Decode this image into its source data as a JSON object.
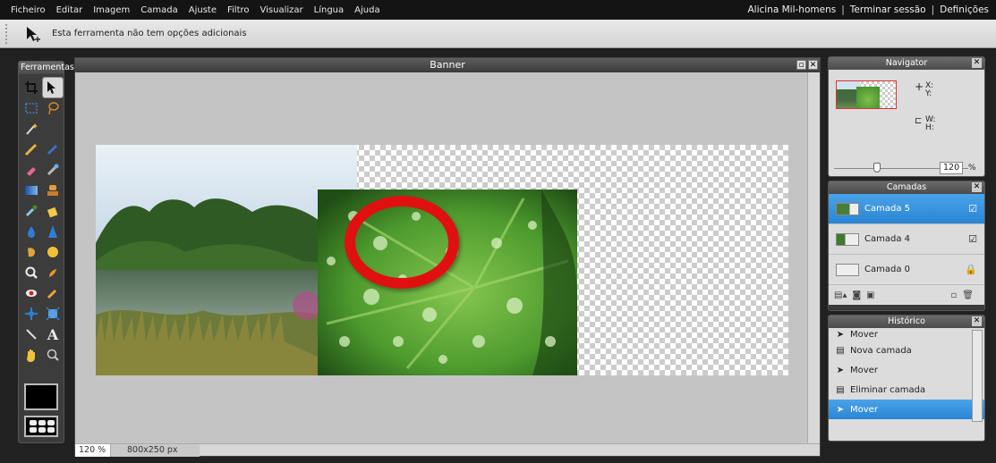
{
  "menu": {
    "items": [
      "Ficheiro",
      "Editar",
      "Imagem",
      "Camada",
      "Ajuste",
      "Filtro",
      "Visualizar",
      "Língua",
      "Ajuda"
    ],
    "user": "Alicina Mil-homens",
    "sep1": "|",
    "logout": "Terminar sessão",
    "sep2": "|",
    "settings": "Definições"
  },
  "options": {
    "message": "Esta ferramenta não tem opções adicionais"
  },
  "toolbox": {
    "title": "Ferramentas"
  },
  "document": {
    "title": "Banner",
    "zoom": "120 %",
    "size": "800x250 px"
  },
  "navigator": {
    "title": "Navigator",
    "x_label": "X:",
    "y_label": "Y:",
    "w_label": "W:",
    "h_label": "H:",
    "zoom_value": "120",
    "zoom_unit": "%"
  },
  "layers": {
    "title": "Camadas",
    "items": [
      {
        "name": "Camada 5",
        "selected": true
      },
      {
        "name": "Camada 4",
        "selected": false
      },
      {
        "name": "Camada 0",
        "selected": false
      }
    ]
  },
  "history": {
    "title": "Histórico",
    "items": [
      {
        "label": "Mover",
        "icon": "move-icon"
      },
      {
        "label": "Nova camada",
        "icon": "new-layer-icon"
      },
      {
        "label": "Mover",
        "icon": "move-icon"
      },
      {
        "label": "Eliminar camada",
        "icon": "delete-layer-icon"
      },
      {
        "label": "Mover",
        "icon": "move-icon",
        "selected": true
      }
    ]
  },
  "colors": {
    "accent": "#2a85d4",
    "highlight_circle": "#e01010"
  }
}
